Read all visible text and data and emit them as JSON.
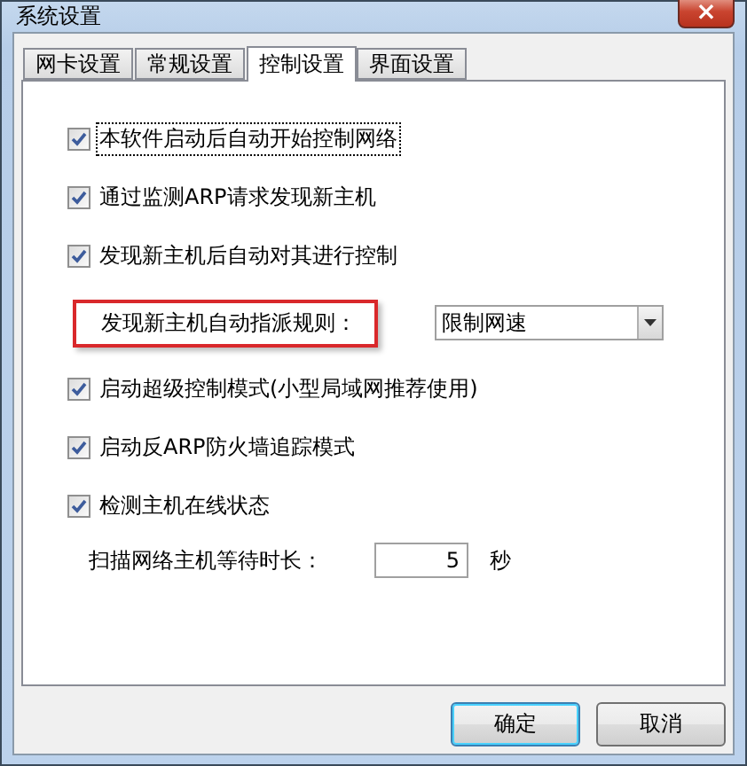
{
  "window": {
    "title": "系统设置",
    "close": "×"
  },
  "tabs": [
    {
      "label": "网卡设置",
      "selected": false
    },
    {
      "label": "常规设置",
      "selected": false
    },
    {
      "label": "控制设置",
      "selected": true
    },
    {
      "label": "界面设置",
      "selected": false
    }
  ],
  "options": [
    {
      "kind": "checkbox",
      "label": "本软件启动后自动开始控制网络",
      "checked": true,
      "focused": true
    },
    {
      "kind": "checkbox",
      "label": "通过监测ARP请求发现新主机",
      "checked": true,
      "focused": false
    },
    {
      "kind": "checkbox",
      "label": "发现新主机后自动对其进行控制",
      "checked": true,
      "focused": false
    },
    {
      "kind": "select",
      "label": "发现新主机自动指派规则：",
      "value": "限制网速",
      "highlighted": true
    },
    {
      "kind": "checkbox",
      "label": "启动超级控制模式(小型局域网推荐使用)",
      "checked": true,
      "focused": false
    },
    {
      "kind": "checkbox",
      "label": "启动反ARP防火墙追踪模式",
      "checked": true,
      "focused": false
    },
    {
      "kind": "checkbox",
      "label": "检测主机在线状态",
      "checked": true,
      "focused": false
    }
  ],
  "scan": {
    "label": "扫描网络主机等待时长：",
    "value": "5",
    "unit": "秒"
  },
  "buttons": [
    {
      "label": "确定",
      "default": true
    },
    {
      "label": "取消",
      "default": false
    }
  ]
}
